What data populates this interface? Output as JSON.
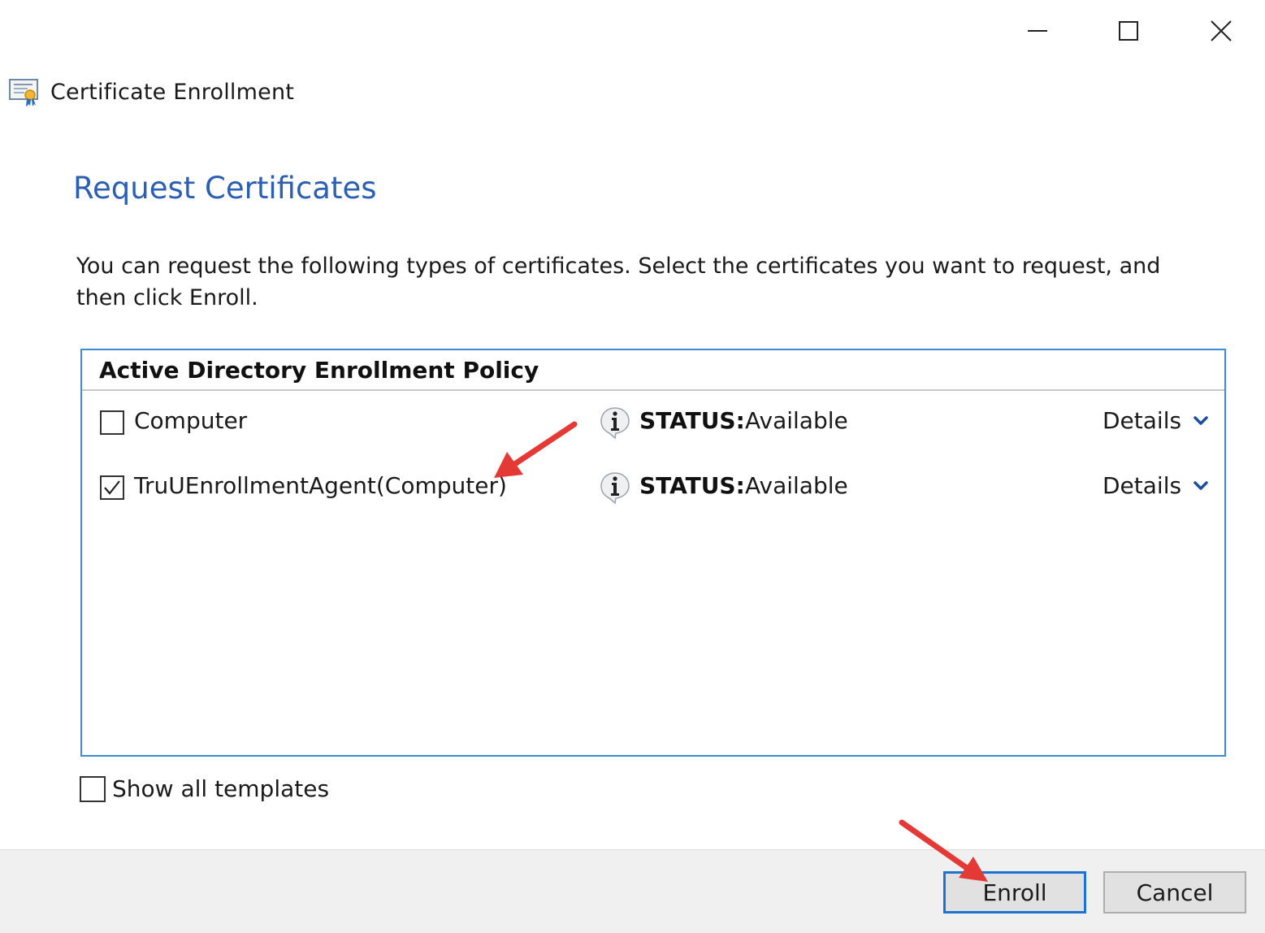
{
  "window": {
    "controls": {
      "minimize": "minimize-icon",
      "maximize": "maximize-icon",
      "close": "close-icon"
    }
  },
  "app": {
    "title": "Certificate Enrollment",
    "icon": "certificate-icon"
  },
  "page": {
    "heading": "Request Certificates",
    "instructions": "You can request the following types of certificates. Select the certificates you want to request, and then click Enroll."
  },
  "policy": {
    "title": "Active Directory Enrollment Policy",
    "certificates": [
      {
        "name": "Computer",
        "checked": false,
        "status_label": "STATUS:",
        "status_value": "Available",
        "details_label": "Details"
      },
      {
        "name": "TruUEnrollmentAgent(Computer)",
        "checked": true,
        "status_label": "STATUS:",
        "status_value": "Available",
        "details_label": "Details"
      }
    ]
  },
  "options": {
    "show_all_templates_label": "Show all templates",
    "show_all_templates_checked": false
  },
  "footer": {
    "enroll_label": "Enroll",
    "cancel_label": "Cancel"
  },
  "colors": {
    "heading": "#2b5fb6",
    "panel_border": "#3c8ad8",
    "enroll_border": "#1f73d0",
    "annotation_arrow": "#e53935"
  }
}
